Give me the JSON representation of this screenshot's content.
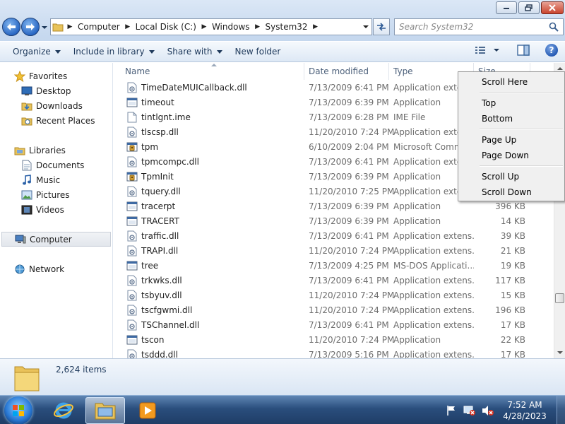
{
  "window": {
    "search_placeholder": "Search System32"
  },
  "breadcrumb": [
    "Computer",
    "Local Disk (C:)",
    "Windows",
    "System32"
  ],
  "toolbar": {
    "organize": "Organize",
    "include_library": "Include in library",
    "share_with": "Share with",
    "new_folder": "New folder"
  },
  "nav": {
    "favorites": "Favorites",
    "desktop": "Desktop",
    "downloads": "Downloads",
    "recent_places": "Recent Places",
    "libraries": "Libraries",
    "documents": "Documents",
    "music": "Music",
    "pictures": "Pictures",
    "videos": "Videos",
    "computer": "Computer",
    "network": "Network"
  },
  "columns": {
    "name": "Name",
    "date": "Date modified",
    "type": "Type",
    "size": "Size"
  },
  "files": [
    {
      "name": "TimeDateMUICallback.dll",
      "date": "7/13/2009 6:41 PM",
      "type": "Application exten",
      "size": "",
      "icon": "dll-icon"
    },
    {
      "name": "timeout",
      "date": "7/13/2009 6:39 PM",
      "type": "Application",
      "size": "",
      "icon": "app-icon"
    },
    {
      "name": "tintlgnt.ime",
      "date": "7/13/2009 6:28 PM",
      "type": "IME File",
      "size": "",
      "icon": "file-icon"
    },
    {
      "name": "tlscsp.dll",
      "date": "11/20/2010 7:24 PM",
      "type": "Application exten",
      "size": "",
      "icon": "dll-icon"
    },
    {
      "name": "tpm",
      "date": "6/10/2009 2:04 PM",
      "type": "Microsoft Comm",
      "size": "",
      "icon": "msc-icon"
    },
    {
      "name": "tpmcompc.dll",
      "date": "7/13/2009 6:41 PM",
      "type": "Application exten",
      "size": "",
      "icon": "dll-icon"
    },
    {
      "name": "TpmInit",
      "date": "7/13/2009 6:39 PM",
      "type": "Application",
      "size": "",
      "icon": "msc-icon"
    },
    {
      "name": "tquery.dll",
      "date": "11/20/2010 7:25 PM",
      "type": "Application exten",
      "size": "",
      "icon": "dll-icon"
    },
    {
      "name": "tracerpt",
      "date": "7/13/2009 6:39 PM",
      "type": "Application",
      "size": "396 KB",
      "icon": "app-icon"
    },
    {
      "name": "TRACERT",
      "date": "7/13/2009 6:39 PM",
      "type": "Application",
      "size": "14 KB",
      "icon": "app-icon"
    },
    {
      "name": "traffic.dll",
      "date": "7/13/2009 6:41 PM",
      "type": "Application extens...",
      "size": "39 KB",
      "icon": "dll-icon"
    },
    {
      "name": "TRAPI.dll",
      "date": "11/20/2010 7:24 PM",
      "type": "Application extens...",
      "size": "21 KB",
      "icon": "dll-icon"
    },
    {
      "name": "tree",
      "date": "7/13/2009 4:25 PM",
      "type": "MS-DOS Applicati...",
      "size": "19 KB",
      "icon": "app-icon"
    },
    {
      "name": "trkwks.dll",
      "date": "7/13/2009 6:41 PM",
      "type": "Application extens...",
      "size": "117 KB",
      "icon": "dll-icon"
    },
    {
      "name": "tsbyuv.dll",
      "date": "11/20/2010 7:24 PM",
      "type": "Application extens...",
      "size": "15 KB",
      "icon": "dll-icon"
    },
    {
      "name": "tscfgwmi.dll",
      "date": "11/20/2010 7:24 PM",
      "type": "Application extens...",
      "size": "196 KB",
      "icon": "dll-icon"
    },
    {
      "name": "TSChannel.dll",
      "date": "7/13/2009 6:41 PM",
      "type": "Application extens...",
      "size": "17 KB",
      "icon": "dll-icon"
    },
    {
      "name": "tscon",
      "date": "11/20/2010 7:24 PM",
      "type": "Application",
      "size": "22 KB",
      "icon": "app-icon"
    },
    {
      "name": "tsddd.dll",
      "date": "7/13/2009 5:16 PM",
      "type": "Application extens...",
      "size": "17 KB",
      "icon": "dll-icon"
    }
  ],
  "context_menu": {
    "scroll_here": "Scroll Here",
    "top": "Top",
    "bottom": "Bottom",
    "page_up": "Page Up",
    "page_down": "Page Down",
    "scroll_up": "Scroll Up",
    "scroll_down": "Scroll Down"
  },
  "details": {
    "item_count": "2,624 items"
  },
  "taskbar": {
    "time": "7:52 AM",
    "date": "4/28/2023"
  },
  "colors": {
    "accent": "#1e395b",
    "taskbar": "#2a4e7d"
  }
}
